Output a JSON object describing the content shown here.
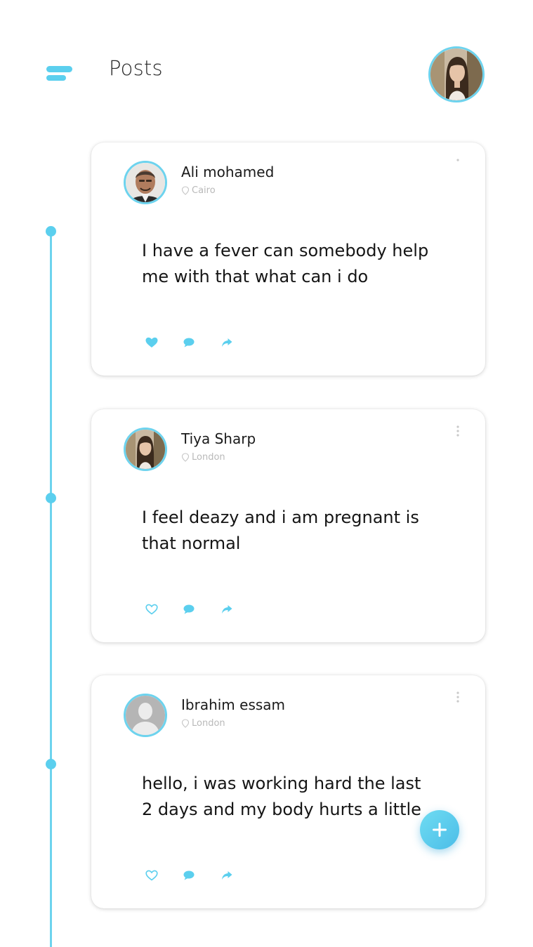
{
  "header": {
    "title": "Posts",
    "menu_icon": "hamburger-menu-icon",
    "profile_avatar": "user-avatar"
  },
  "colors": {
    "accent": "#5bcfee",
    "text": "#1a1a1a",
    "muted": "#b9b9b9"
  },
  "posts": [
    {
      "author": "Ali mohamed",
      "location": "Cairo",
      "text": "I have a fever can somebody help me with that what can i do",
      "liked": true
    },
    {
      "author": "Tiya Sharp",
      "location": "London",
      "text": "I feel deazy and i am pregnant is that normal",
      "liked": false
    },
    {
      "author": "Ibrahim essam",
      "location": "London",
      "text": "hello, i was working hard the last 2 days and my body hurts a little",
      "liked": false
    }
  ],
  "fab": {
    "icon": "plus-icon"
  }
}
